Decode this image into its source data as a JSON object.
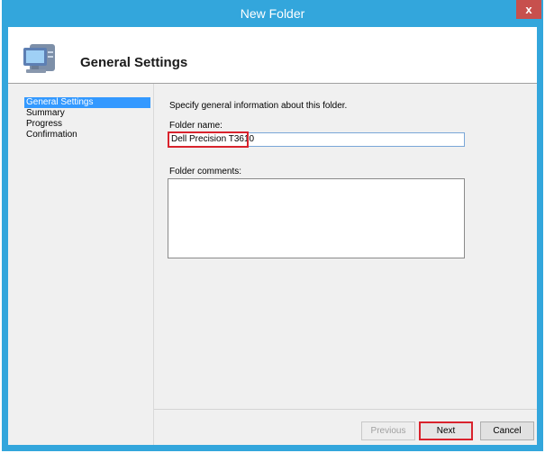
{
  "window": {
    "title": "New Folder",
    "close_label": "x"
  },
  "header": {
    "title": "General Settings",
    "icon": "computer-group-icon"
  },
  "nav": {
    "items": [
      {
        "label": "General Settings",
        "active": true
      },
      {
        "label": "Summary",
        "active": false
      },
      {
        "label": "Progress",
        "active": false
      },
      {
        "label": "Confirmation",
        "active": false
      }
    ]
  },
  "main": {
    "description": "Specify general information about this folder.",
    "folder_name_label": "Folder name:",
    "folder_name_value": "Dell Precision T3610",
    "folder_comments_label": "Folder comments:",
    "folder_comments_value": ""
  },
  "buttons": {
    "previous": "Previous",
    "next": "Next",
    "cancel": "Cancel"
  },
  "colors": {
    "titlebar": "#33a6dc",
    "close": "#c7504d",
    "selection": "#3399ff",
    "highlight": "#d9232d"
  }
}
